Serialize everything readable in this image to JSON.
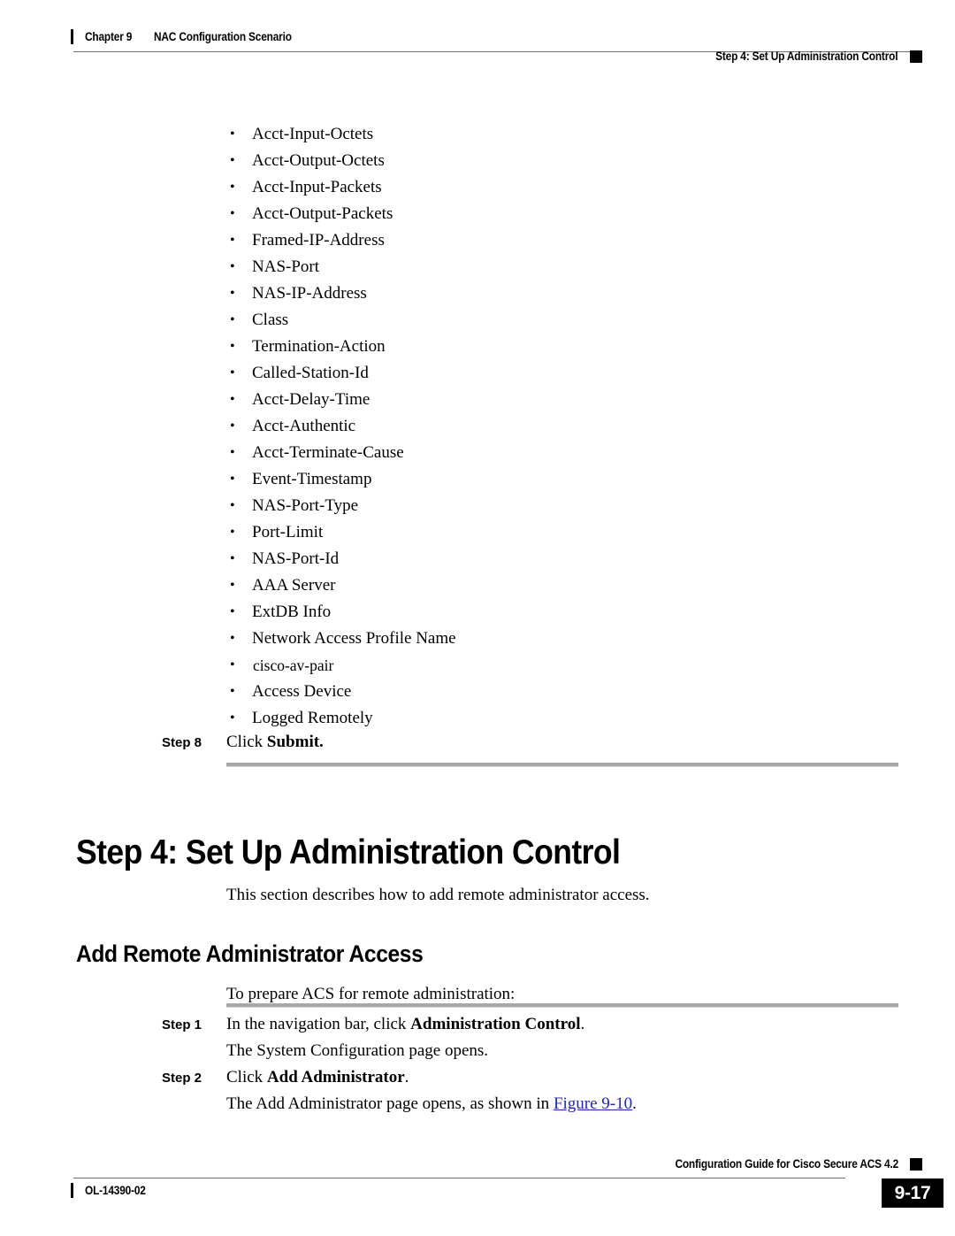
{
  "header": {
    "chapter_label": "Chapter 9",
    "chapter_title": "NAC Configuration Scenario",
    "section_title": "Step 4: Set Up Administration Control"
  },
  "bullets": [
    "Acct-Input-Octets",
    "Acct-Output-Octets",
    "Acct-Input-Packets",
    "Acct-Output-Packets",
    "Framed-IP-Address",
    "NAS-Port",
    "NAS-IP-Address",
    "Class",
    "Termination-Action",
    "Called-Station-Id",
    "Acct-Delay-Time",
    "Acct-Authentic",
    "Acct-Terminate-Cause",
    "Event-Timestamp",
    "NAS-Port-Type",
    "Port-Limit",
    "NAS-Port-Id",
    "AAA Server",
    "ExtDB Info",
    "Network Access Profile Name",
    "cisco-av-pair",
    "Access Device",
    "Logged Remotely"
  ],
  "step8": {
    "label": "Step 8",
    "text_plain": "Click ",
    "text_bold": "Submit."
  },
  "heading1": "Step 4: Set Up Administration Control",
  "intro_para": "This section describes how to add remote administrator access.",
  "heading2": "Add Remote Administrator Access",
  "prepare_para": "To prepare ACS for remote administration:",
  "step1": {
    "label": "Step 1",
    "text_plain": "In the navigation bar, click ",
    "text_bold": "Administration Control",
    "text_tail": ".",
    "continuation": "The System Configuration page opens."
  },
  "step2": {
    "label": "Step 2",
    "text_plain": "Click ",
    "text_bold": "Add Administrator",
    "text_tail": ".",
    "continuation_lead": "The Add Administrator page opens, as shown in ",
    "continuation_link": "Figure 9-10",
    "continuation_tail": "."
  },
  "footer": {
    "doc_id": "OL-14390-02",
    "guide_title": "Configuration Guide for Cisco Secure ACS 4.2",
    "page_number": "9-17"
  },
  "colors": {
    "link": "#2323c8",
    "rule_gray": "#a8a8a8",
    "rule_thin": "#6f6f6f"
  }
}
